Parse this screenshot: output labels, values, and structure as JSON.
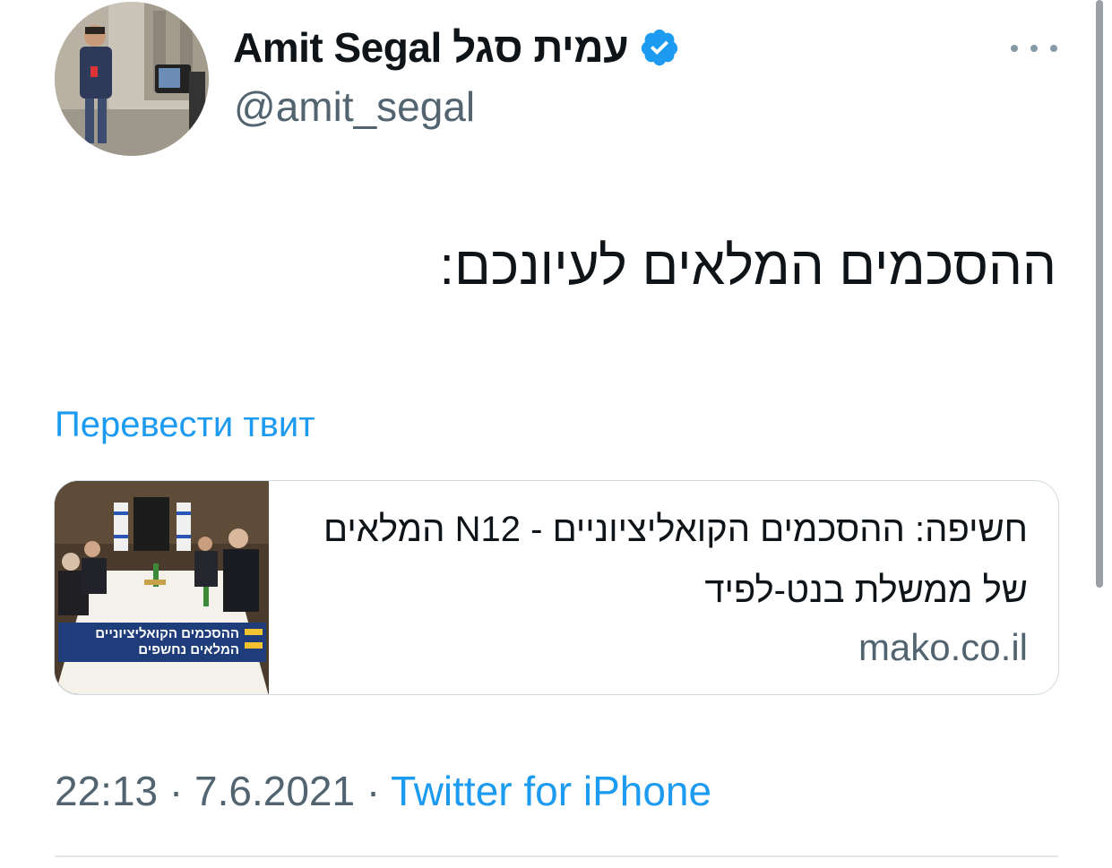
{
  "author": {
    "display_name": "Amit Segal עמית סגל",
    "handle": "@amit_segal",
    "verified": true
  },
  "tweet": {
    "text": "ההסכמים המלאים לעיונכם:",
    "translate_label": "Перевести твит"
  },
  "link_card": {
    "title": "חשיפה: ההסכמים הקואליציוניים - N12 המלאים של ממשלת בנט-לפיד",
    "domain": "mako.co.il",
    "thumbnail_caption_line1": "ההסכמים הקואליציוניים",
    "thumbnail_caption_line2": "המלאים נחשפים"
  },
  "meta": {
    "time": "22:13",
    "date": "7.6.2021",
    "separator": "·",
    "source": "Twitter for iPhone"
  },
  "colors": {
    "accent": "#1d9bf0",
    "secondary_text": "#536471",
    "border": "#cfd9de"
  },
  "icons": {
    "verified": "verified-badge-icon",
    "more": "more-horizontal-icon"
  }
}
